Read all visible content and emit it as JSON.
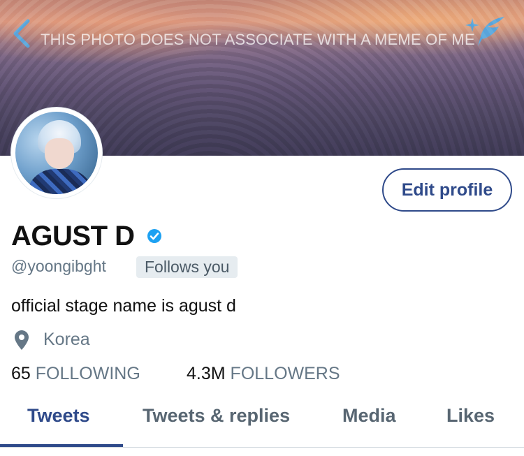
{
  "header": {
    "caption": "THIS PHOTO DOES NOT ASSOCIATE WITH A MEME OF ME",
    "back_icon": "chevron-left-icon",
    "compose_icon": "quill-icon",
    "accent": "#5ea9dd"
  },
  "profile": {
    "name": "AGUST D",
    "verified": true,
    "handle": "@yoongibght",
    "follows_badge": "Follows you",
    "bio": "official stage name is agust d",
    "location": "Korea",
    "following_count": "65",
    "following_label": "FOLLOWING",
    "followers_count": "4.3M",
    "followers_label": "FOLLOWERS",
    "edit_button": "Edit profile"
  },
  "tabs": [
    {
      "label": "Tweets",
      "active": true
    },
    {
      "label": "Tweets & replies",
      "active": false
    },
    {
      "label": "Media",
      "active": false
    },
    {
      "label": "Likes",
      "active": false
    }
  ],
  "colors": {
    "brand": "#2f4a8a",
    "verified_blue": "#1da1f2",
    "muted": "#657786"
  }
}
